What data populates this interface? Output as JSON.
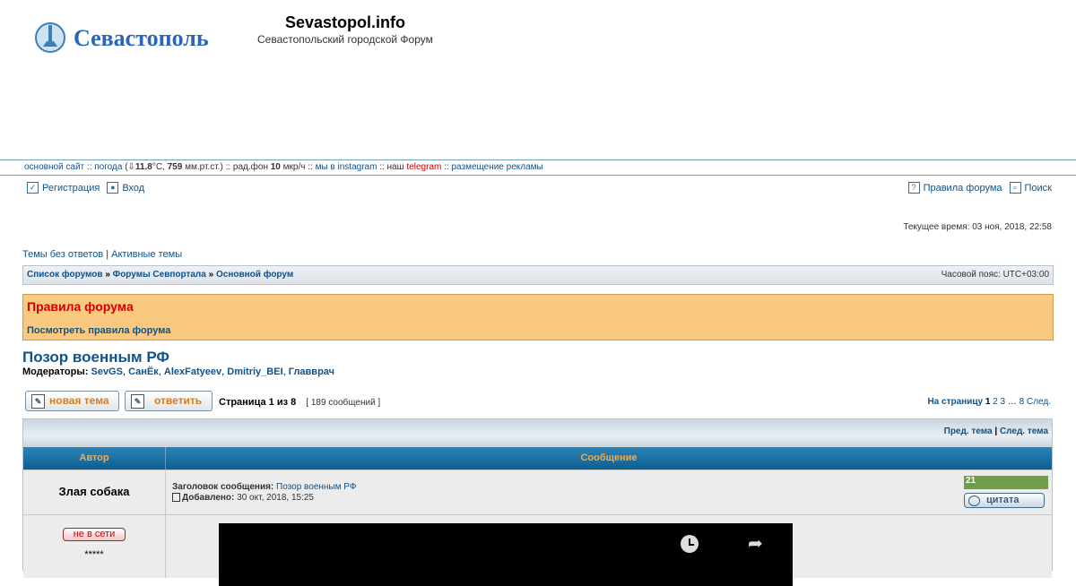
{
  "site": {
    "logo_text": "Севастополь",
    "title": "Sevastopol.info",
    "description": "Севастопольский городской Форум"
  },
  "topstrip": {
    "main_site": "основной сайт",
    "weather_label": "погода",
    "temp_pre": "(⇩",
    "temp": "11.8",
    "temp_unit": "°C,",
    "pressure": "759",
    "pressure_unit": "мм.рт.ст.)",
    "radiation_label": ":: рад.фон",
    "radiation": "10",
    "radiation_unit": "мкр/ч ::",
    "instagram": "мы в instagram",
    "our": ":: наш",
    "telegram": "telegram",
    "ads": "размещение рекламы",
    "sep": "::"
  },
  "usernav": {
    "register": "Регистрация",
    "login": "Вход",
    "rules": "Правила форума",
    "search": "Поиск"
  },
  "current_time": "Текущее время: 03 ноя, 2018, 22:58",
  "quicklinks": {
    "unanswered": "Темы без ответов",
    "sep": "|",
    "active": "Активные темы"
  },
  "breadcrumbs": {
    "items": [
      "Список форумов",
      "Форумы Севпортала",
      "Основной форум"
    ],
    "sep": "»",
    "timezone": "Часовой пояс: UTC+03:00"
  },
  "rules_box": {
    "title": "Правила форума",
    "link": "Посмотреть правила форума"
  },
  "forum": {
    "title": "Позор военным РФ",
    "moderators_label": "Модераторы:",
    "moderators": [
      "SevGS",
      "СанЁк",
      "AlexFatyeev",
      "Dmitriy_BEI",
      "Главврач"
    ]
  },
  "actions": {
    "new_topic": "новая тема",
    "reply": "ответить",
    "page_info": "Страница 1 из 8",
    "posts_count": "[ 189 сообщений ]",
    "goto_page": "На страницу",
    "pages": [
      "1",
      "2",
      "3",
      "…",
      "8"
    ],
    "next": "След."
  },
  "topic_nav": {
    "prev": "Пред. тема",
    "sep": "|",
    "next": "След. тема"
  },
  "table_header": {
    "author": "Автор",
    "message": "Сообщение"
  },
  "post": {
    "author": "Злая собака",
    "subject_label": "Заголовок сообщения:",
    "subject": "Позор военным РФ",
    "added_label": "Добавлено:",
    "added": "30 окт, 2018, 15:25",
    "rating": "21",
    "quote": "цитата",
    "status": "не в сети",
    "rank": "*****"
  },
  "colors": {
    "link": "#105289",
    "header_bar": "#1a6fa3",
    "rules_bg": "#f8c97f",
    "rules_title": "#d10000",
    "rating_bg": "#6f9e4a"
  }
}
